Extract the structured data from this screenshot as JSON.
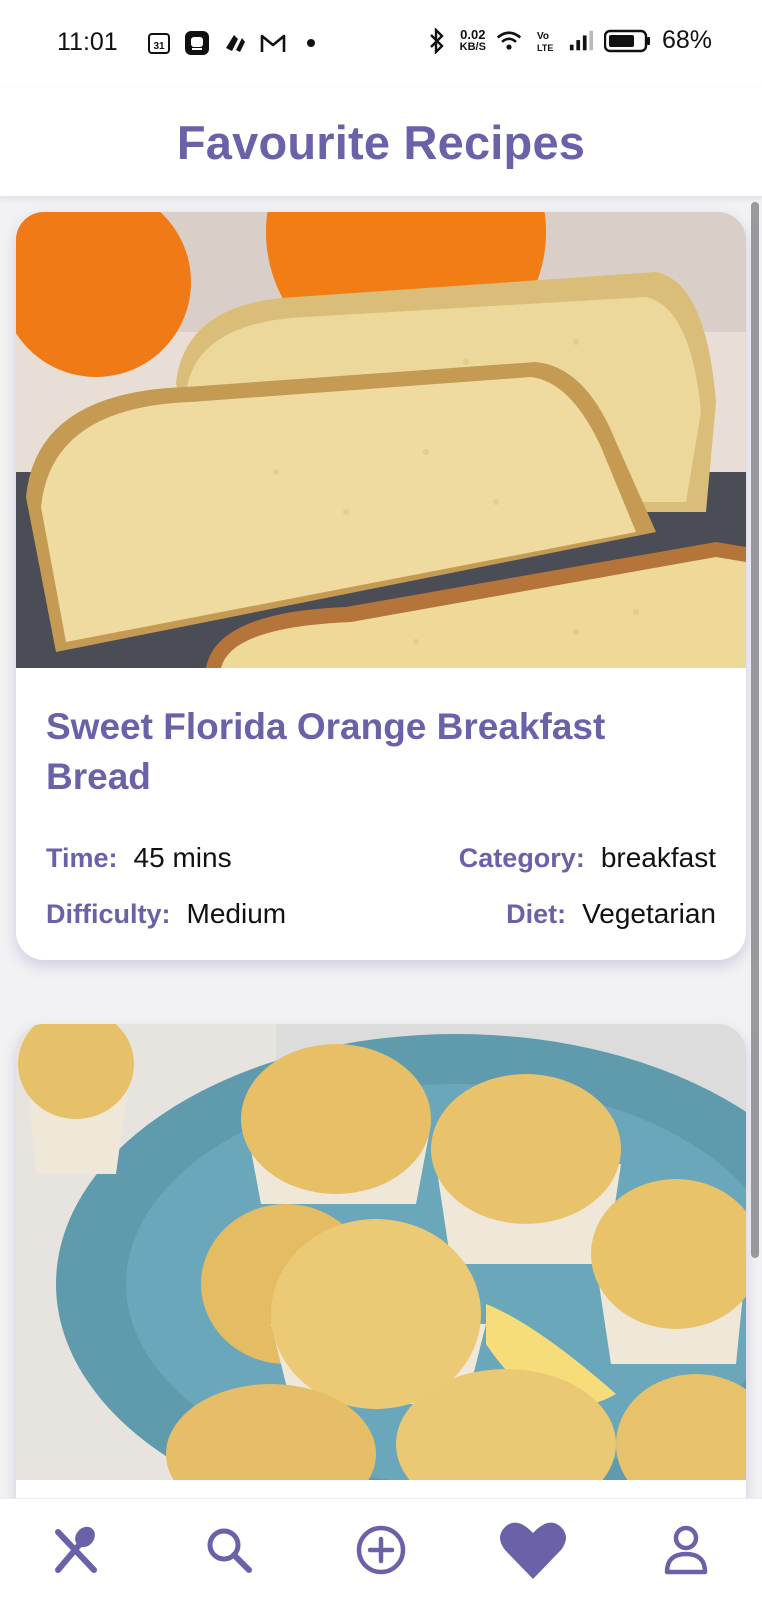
{
  "status_bar": {
    "time": "11:01",
    "left_icons": [
      "calendar-icon",
      "messaging-app-icon",
      "app-icon",
      "gmail-icon",
      "notification-dot-icon"
    ],
    "calendar_day": "31",
    "net_speed_value": "0.02",
    "net_speed_unit": "KB/S",
    "right_icons": [
      "bluetooth-icon",
      "wifi-icon",
      "volte-icon",
      "signal-icon",
      "battery-icon"
    ],
    "battery_percent": "68%"
  },
  "header": {
    "title": "Favourite Recipes"
  },
  "colors": {
    "accent": "#6a62a8",
    "background": "#f2f2f4"
  },
  "recipes": [
    {
      "title": "Sweet Florida Orange Breakfast Bread",
      "time_label": "Time:",
      "time": "45 mins",
      "category_label": "Category:",
      "category": "breakfast",
      "difficulty_label": "Difficulty:",
      "difficulty": "Medium",
      "diet_label": "Diet:",
      "diet": "Vegetarian"
    },
    {}
  ],
  "bottom_nav": {
    "items": [
      {
        "icon": "utensils-icon",
        "active": false
      },
      {
        "icon": "search-icon",
        "active": false
      },
      {
        "icon": "add-circle-icon",
        "active": false
      },
      {
        "icon": "heart-icon",
        "active": true
      },
      {
        "icon": "profile-icon",
        "active": false
      }
    ]
  }
}
